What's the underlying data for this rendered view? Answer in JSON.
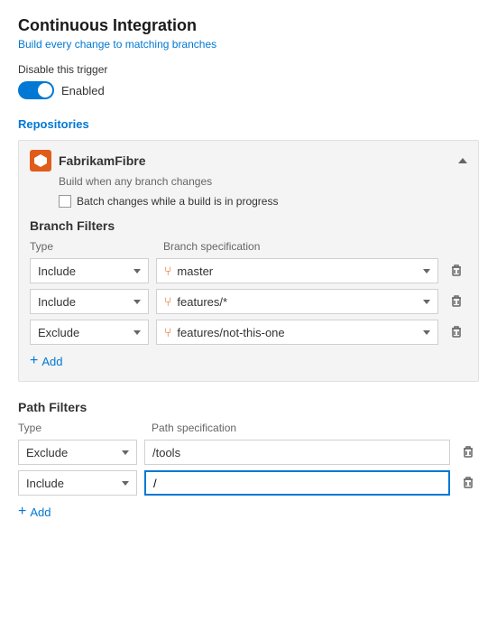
{
  "page": {
    "title": "Continuous Integration",
    "subtitle": "Build every change to matching branches"
  },
  "disable_trigger": {
    "label": "Disable this trigger",
    "toggle_state": "Enabled"
  },
  "repositories": {
    "section_title": "Repositories",
    "repo": {
      "name": "FabrikamFibre",
      "subtitle": "Build when any branch changes",
      "batch_label": "Batch changes while a build is in progress"
    }
  },
  "branch_filters": {
    "title": "Branch Filters",
    "type_col": "Type",
    "spec_col": "Branch specification",
    "rows": [
      {
        "type": "Include",
        "spec": "master"
      },
      {
        "type": "Include",
        "spec": "features/*"
      },
      {
        "type": "Exclude",
        "spec": "features/not-this-one"
      }
    ],
    "add_label": "Add"
  },
  "path_filters": {
    "title": "Path Filters",
    "type_col": "Type",
    "spec_col": "Path specification",
    "rows": [
      {
        "type": "Exclude",
        "spec": "/tools",
        "active": false
      },
      {
        "type": "Include",
        "spec": "/",
        "active": true
      }
    ],
    "add_label": "Add"
  },
  "icons": {
    "delete": "🗑",
    "branch": "⑂",
    "plus": "+"
  }
}
